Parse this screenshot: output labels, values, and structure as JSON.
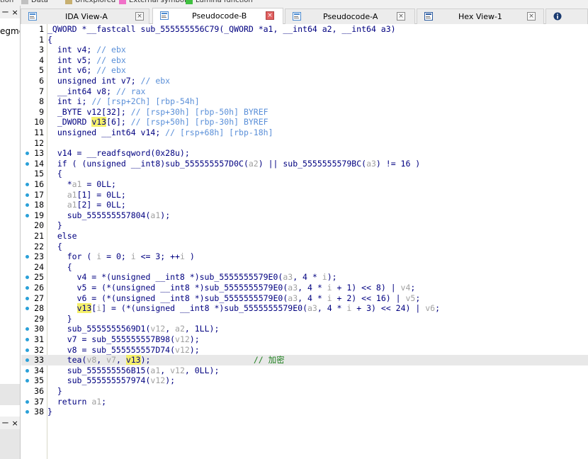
{
  "legend": [
    {
      "label": "tion",
      "color": ""
    },
    {
      "label": "Data",
      "color": "#c0c0c0"
    },
    {
      "label": "Unexplored",
      "color": "#c8b070"
    },
    {
      "label": "External symbol",
      "color": "#f070c8"
    },
    {
      "label": "Lumina function",
      "color": "#40c040"
    }
  ],
  "tabs": [
    {
      "label": "IDA View-A",
      "active": false,
      "icon": "ida-view-icon"
    },
    {
      "label": "Pseudocode-B",
      "active": true,
      "icon": "pseudocode-icon"
    },
    {
      "label": "Pseudocode-A",
      "active": false,
      "icon": "pseudocode-icon"
    },
    {
      "label": "Hex View-1",
      "active": false,
      "icon": "hex-view-icon"
    }
  ],
  "left_panel": {
    "segment_text": "egme",
    "header_glyphs": "ㄧ ×"
  },
  "current_line": 33,
  "code_lines": [
    {
      "n": "1",
      "dot": false,
      "segs": [
        [
          "",
          "_QWORD *__fastcall sub_555555556C79(_QWORD *a1, __int64 a2, __int64 a3)"
        ]
      ]
    },
    {
      "n": "1",
      "dot": false,
      "segs": [
        [
          "",
          "{"
        ]
      ]
    },
    {
      "n": "3",
      "dot": false,
      "segs": [
        [
          "",
          "  int v4; "
        ],
        [
          "cm",
          "// ebx"
        ]
      ]
    },
    {
      "n": "4",
      "dot": false,
      "segs": [
        [
          "",
          "  int v5; "
        ],
        [
          "cm",
          "// ebx"
        ]
      ]
    },
    {
      "n": "5",
      "dot": false,
      "segs": [
        [
          "",
          "  int v6; "
        ],
        [
          "cm",
          "// ebx"
        ]
      ]
    },
    {
      "n": "6",
      "dot": false,
      "segs": [
        [
          "",
          "  unsigned int v7; "
        ],
        [
          "cm",
          "// ebx"
        ]
      ]
    },
    {
      "n": "7",
      "dot": false,
      "segs": [
        [
          "",
          "  __int64 v8; "
        ],
        [
          "cm",
          "// rax"
        ]
      ]
    },
    {
      "n": "8",
      "dot": false,
      "segs": [
        [
          "",
          "  int i; "
        ],
        [
          "cm",
          "// [rsp+2Ch] [rbp-54h]"
        ]
      ]
    },
    {
      "n": "9",
      "dot": false,
      "segs": [
        [
          "",
          "  _BYTE v12[32]; "
        ],
        [
          "cm",
          "// [rsp+30h] [rbp-50h] BYREF"
        ]
      ]
    },
    {
      "n": "10",
      "dot": false,
      "segs": [
        [
          "",
          "  _DWORD "
        ],
        [
          "hl",
          "v13"
        ],
        [
          "",
          "[6]; "
        ],
        [
          "cm",
          "// [rsp+50h] [rbp-30h] BYREF"
        ]
      ]
    },
    {
      "n": "11",
      "dot": false,
      "segs": [
        [
          "",
          "  unsigned __int64 v14; "
        ],
        [
          "cm",
          "// [rsp+68h] [rbp-18h]"
        ]
      ]
    },
    {
      "n": "12",
      "dot": false,
      "segs": [
        [
          "",
          ""
        ]
      ]
    },
    {
      "n": "13",
      "dot": true,
      "segs": [
        [
          "",
          "  v14 = __readfsqword(0x28u);"
        ]
      ]
    },
    {
      "n": "14",
      "dot": true,
      "segs": [
        [
          "",
          "  if ( (unsigned __int8)sub_555555557D0C("
        ],
        [
          "var",
          "a2"
        ],
        [
          "",
          ") || sub_5555555579BC("
        ],
        [
          "var",
          "a3"
        ],
        [
          "",
          ") != 16 )"
        ]
      ]
    },
    {
      "n": "15",
      "dot": false,
      "segs": [
        [
          "",
          "  {"
        ]
      ]
    },
    {
      "n": "16",
      "dot": true,
      "segs": [
        [
          "",
          "    *"
        ],
        [
          "var",
          "a1"
        ],
        [
          "",
          " = 0LL;"
        ]
      ]
    },
    {
      "n": "17",
      "dot": true,
      "segs": [
        [
          "",
          "    "
        ],
        [
          "var",
          "a1"
        ],
        [
          "",
          "[1] = 0LL;"
        ]
      ]
    },
    {
      "n": "18",
      "dot": true,
      "segs": [
        [
          "",
          "    "
        ],
        [
          "var",
          "a1"
        ],
        [
          "",
          "[2] = 0LL;"
        ]
      ]
    },
    {
      "n": "19",
      "dot": true,
      "segs": [
        [
          "",
          "    sub_555555557804("
        ],
        [
          "var",
          "a1"
        ],
        [
          "",
          ");"
        ]
      ]
    },
    {
      "n": "20",
      "dot": false,
      "segs": [
        [
          "",
          "  }"
        ]
      ]
    },
    {
      "n": "21",
      "dot": false,
      "segs": [
        [
          "",
          "  else"
        ]
      ]
    },
    {
      "n": "22",
      "dot": false,
      "segs": [
        [
          "",
          "  {"
        ]
      ]
    },
    {
      "n": "23",
      "dot": true,
      "segs": [
        [
          "",
          "    for ( "
        ],
        [
          "var",
          "i"
        ],
        [
          "",
          " = 0; "
        ],
        [
          "var",
          "i"
        ],
        [
          "",
          " <= 3; ++"
        ],
        [
          "var",
          "i"
        ],
        [
          "",
          " )"
        ]
      ]
    },
    {
      "n": "24",
      "dot": false,
      "segs": [
        [
          "",
          "    {"
        ]
      ]
    },
    {
      "n": "25",
      "dot": true,
      "segs": [
        [
          "",
          "      v4 = *(unsigned __int8 *)sub_5555555579E0("
        ],
        [
          "var",
          "a3"
        ],
        [
          "",
          ", 4 * "
        ],
        [
          "var",
          "i"
        ],
        [
          "",
          ");"
        ]
      ]
    },
    {
      "n": "26",
      "dot": true,
      "segs": [
        [
          "",
          "      v5 = (*(unsigned __int8 *)sub_5555555579E0("
        ],
        [
          "var",
          "a3"
        ],
        [
          "",
          ", 4 * "
        ],
        [
          "var",
          "i"
        ],
        [
          "",
          " + 1) << 8) | "
        ],
        [
          "var",
          "v4"
        ],
        [
          "",
          ";"
        ]
      ]
    },
    {
      "n": "27",
      "dot": true,
      "segs": [
        [
          "",
          "      v6 = (*(unsigned __int8 *)sub_5555555579E0("
        ],
        [
          "var",
          "a3"
        ],
        [
          "",
          ", 4 * "
        ],
        [
          "var",
          "i"
        ],
        [
          "",
          " + 2) << 16) | "
        ],
        [
          "var",
          "v5"
        ],
        [
          "",
          ";"
        ]
      ]
    },
    {
      "n": "28",
      "dot": true,
      "segs": [
        [
          "",
          "      "
        ],
        [
          "hl",
          "v13"
        ],
        [
          "",
          "["
        ],
        [
          "var",
          "i"
        ],
        [
          "",
          "] = (*(unsigned __int8 *)sub_5555555579E0("
        ],
        [
          "var",
          "a3"
        ],
        [
          "",
          ", 4 * "
        ],
        [
          "var",
          "i"
        ],
        [
          "",
          " + 3) << 24) | "
        ],
        [
          "var",
          "v6"
        ],
        [
          "",
          ";"
        ]
      ]
    },
    {
      "n": "29",
      "dot": false,
      "segs": [
        [
          "",
          "    }"
        ]
      ]
    },
    {
      "n": "30",
      "dot": true,
      "segs": [
        [
          "",
          "    sub_5555555569D1("
        ],
        [
          "var",
          "v12"
        ],
        [
          "",
          ", "
        ],
        [
          "var",
          "a2"
        ],
        [
          "",
          ", 1LL);"
        ]
      ]
    },
    {
      "n": "31",
      "dot": true,
      "segs": [
        [
          "",
          "    v7 = sub_555555557B98("
        ],
        [
          "var",
          "v12"
        ],
        [
          "",
          ");"
        ]
      ]
    },
    {
      "n": "32",
      "dot": true,
      "segs": [
        [
          "",
          "    v8 = sub_555555557D74("
        ],
        [
          "var",
          "v12"
        ],
        [
          "",
          ");"
        ]
      ]
    },
    {
      "n": "33",
      "dot": true,
      "segs": [
        [
          "",
          "    tea("
        ],
        [
          "var",
          "v8"
        ],
        [
          "",
          ", "
        ],
        [
          "var",
          "v7"
        ],
        [
          "",
          ", "
        ],
        [
          "hl",
          "v13"
        ],
        [
          "",
          ");                     "
        ],
        [
          "green",
          "// 加密"
        ]
      ]
    },
    {
      "n": "34",
      "dot": true,
      "segs": [
        [
          "",
          "    sub_555555556B15("
        ],
        [
          "var",
          "a1"
        ],
        [
          "",
          ", "
        ],
        [
          "var",
          "v12"
        ],
        [
          "",
          ", 0LL);"
        ]
      ]
    },
    {
      "n": "35",
      "dot": true,
      "segs": [
        [
          "",
          "    sub_555555557974("
        ],
        [
          "var",
          "v12"
        ],
        [
          "",
          ");"
        ]
      ]
    },
    {
      "n": "36",
      "dot": false,
      "segs": [
        [
          "",
          "  }"
        ]
      ]
    },
    {
      "n": "37",
      "dot": true,
      "segs": [
        [
          "",
          "  return "
        ],
        [
          "var",
          "a1"
        ],
        [
          "",
          ";"
        ]
      ]
    },
    {
      "n": "38",
      "dot": true,
      "segs": [
        [
          "",
          "}"
        ]
      ]
    }
  ]
}
